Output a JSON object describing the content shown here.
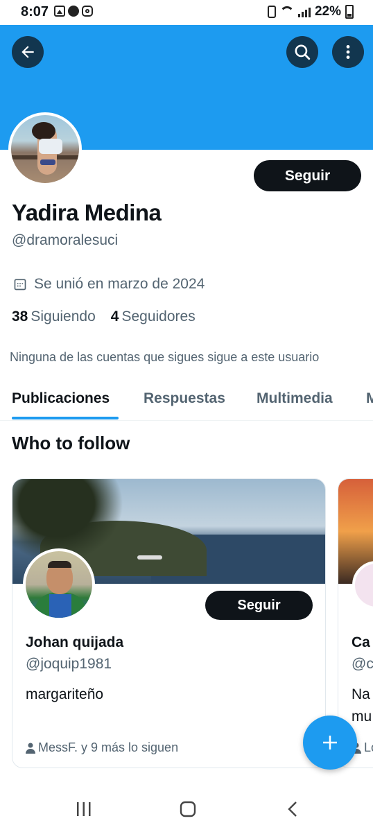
{
  "status_bar": {
    "time": "8:07",
    "battery": "22%"
  },
  "header": {
    "back_icon": "arrow-left-icon",
    "search_icon": "search-icon",
    "more_icon": "more-vertical-icon",
    "banner_color": "#1d9bf0"
  },
  "profile": {
    "name": "Yadira Medina",
    "handle": "@dramoralesuci",
    "follow_label": "Seguir",
    "joined": "Se unió en marzo de 2024",
    "following_count": "38",
    "following_label": "Siguiendo",
    "followers_count": "4",
    "followers_label": "Seguidores",
    "mutual_note": "Ninguna de las cuentas que sigues sigue a este usuario"
  },
  "tabs": [
    {
      "label": "Publicaciones",
      "active": true
    },
    {
      "label": "Respuestas",
      "active": false
    },
    {
      "label": "Multimedia",
      "active": false
    },
    {
      "label": "M",
      "active": false
    }
  ],
  "who_to_follow": {
    "title": "Who to follow",
    "cards": [
      {
        "name": "Johan quijada",
        "handle": "@joquip1981",
        "bio": "margariteño",
        "follow_label": "Seguir",
        "followed_by": "MessF. y 9 más lo siguen"
      },
      {
        "name": "Ca",
        "handle": "@c",
        "bio_line1": "Na",
        "bio_line2": "mu",
        "followed_by": "Lo"
      }
    ]
  },
  "fab": {
    "icon": "plus-icon",
    "color": "#1d9bf0"
  },
  "navbar": {
    "recent_icon": "recent-apps-icon",
    "home_icon": "home-icon",
    "back_icon": "nav-back-icon"
  }
}
